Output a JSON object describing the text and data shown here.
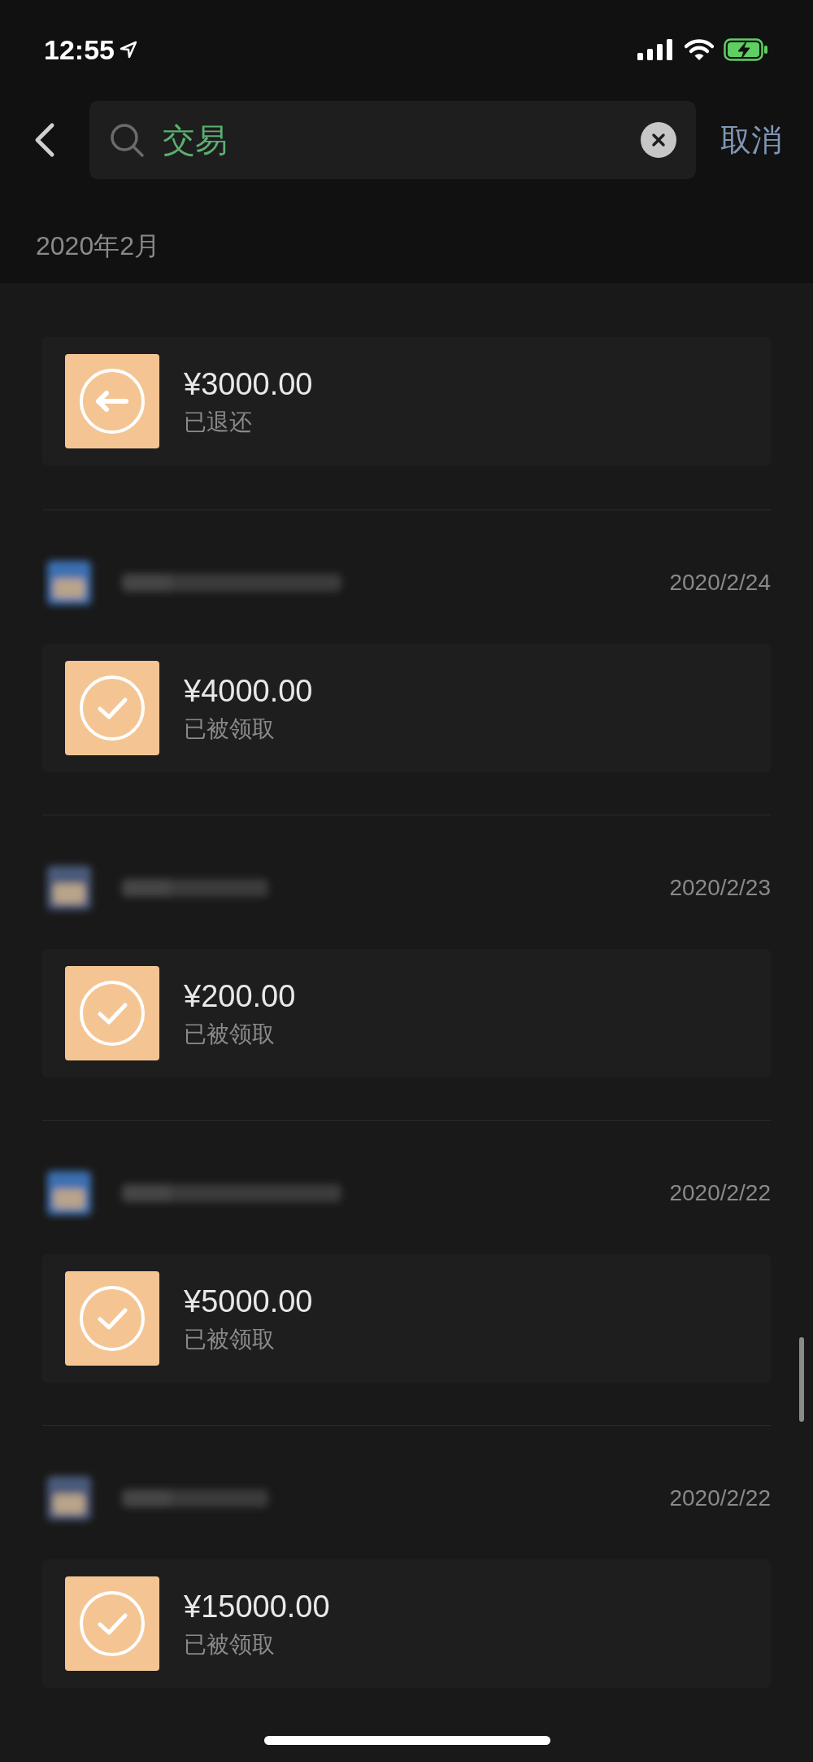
{
  "status_bar": {
    "time": "12:55"
  },
  "search": {
    "value": "交易",
    "cancel": "取消"
  },
  "section_title": "2020年2月",
  "transactions": [
    {
      "kind": "refund",
      "amount": "¥3000.00",
      "status": "已退还"
    },
    {
      "kind": "received",
      "date": "2020/2/24",
      "amount": "¥4000.00",
      "status": "已被领取"
    },
    {
      "kind": "received",
      "date": "2020/2/23",
      "amount": "¥200.00",
      "status": "已被领取"
    },
    {
      "kind": "received",
      "date": "2020/2/22",
      "amount": "¥5000.00",
      "status": "已被领取"
    },
    {
      "kind": "received",
      "date": "2020/2/22",
      "amount": "¥15000.00",
      "status": "已被领取"
    }
  ]
}
